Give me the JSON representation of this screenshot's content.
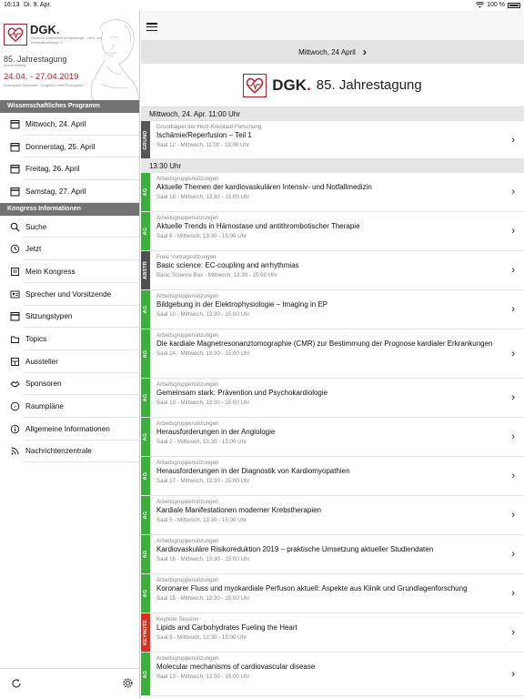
{
  "status": {
    "time": "16:13",
    "date": "Di. 9. Apr.",
    "battery": "100 %"
  },
  "banner": {
    "brand": "DGK",
    "society": "Deutsche Gesellschaft für Kardiologie – Herz- und Kreislaufforschung e.V.",
    "anniversary": "85. Jahrestagung",
    "annual": "Annual Meeting",
    "dates": "24.04. - 27.04.2019",
    "venue": "Rosengarten Mannheim · Congress Center Rosengarten"
  },
  "sidebar": {
    "section1": "Wissenschaftliches Programm",
    "days": [
      {
        "label": "Mittwoch, 24. April",
        "icon": "calendar-icon"
      },
      {
        "label": "Donnerstag, 25. April",
        "icon": "calendar-icon"
      },
      {
        "label": "Freitag, 26. April",
        "icon": "calendar-icon"
      },
      {
        "label": "Samstag, 27. April",
        "icon": "calendar-icon"
      }
    ],
    "section2": "Kongress Informationen",
    "items": [
      {
        "label": "Suche",
        "icon": "search-icon"
      },
      {
        "label": "Jetzt",
        "icon": "clock-icon"
      },
      {
        "label": "Mein Kongress",
        "icon": "my-congress-icon"
      },
      {
        "label": "Sprecher und Vorsitzende",
        "icon": "speakers-icon"
      },
      {
        "label": "Sitzungstypen",
        "icon": "session-types-icon"
      },
      {
        "label": "Topics",
        "icon": "topics-icon"
      },
      {
        "label": "Aussteller",
        "icon": "exhibitors-icon"
      },
      {
        "label": "Sponsoren",
        "icon": "sponsors-icon"
      },
      {
        "label": "Raumpläne",
        "icon": "location-icon"
      },
      {
        "label": "Allgemeine Informationen",
        "icon": "info-icon"
      },
      {
        "label": "Nachrichtenzentrale",
        "icon": "news-icon"
      }
    ]
  },
  "main": {
    "day_nav": "Mittwoch, 24 April",
    "logo_brand": "DGK",
    "logo_title": "85. Jahrestagung",
    "time1": "Mittwoch, 24. Apr. 11:00 Uhr",
    "time2": "13:30 Uhr",
    "sessions": [
      {
        "tag": "GRUND",
        "cat": "Grundlagen der Herz-Kreislauf-Forschung",
        "title": "Ischämie/Reperfusion – Teil 1",
        "meta": "Saal 12 - Mittwoch, 11:00 - 13:00 Uhr"
      },
      {
        "tag": "AG",
        "cat": "Arbeitsgruppensitzungen",
        "title": "Aktuelle Themen der kardiovaskulären Intensiv- und Notfallmedizin",
        "meta": "Saal 18 - Mittwoch, 13:30 - 15:00 Uhr"
      },
      {
        "tag": "AG",
        "cat": "Arbeitsgruppensitzungen",
        "title": "Aktuelle Trends in Hämostase und antithrombotischer Therapie",
        "meta": "Saal 6 - Mittwoch, 13:30 - 15:00 Uhr"
      },
      {
        "tag": "ABSTR",
        "cat": "Freie Vortragssitzungen",
        "title": "Basic science: EC-coupling and arrhythmias",
        "meta": "Basic Science Box - Mittwoch, 13:30 - 15:00 Uhr"
      },
      {
        "tag": "AG",
        "cat": "Arbeitsgruppensitzungen",
        "title": "Bildgebung in der Elektrophysiologie – Imaging in EP",
        "meta": "Saal 10 - Mittwoch, 13:30 - 15:00 Uhr"
      },
      {
        "tag": "AG",
        "cat": "Arbeitsgruppensitzungen",
        "title": "Die kardiale Magnetresonanztomographie (CMR) zur Bestimmung der Prognose kardialer Erkrankungen",
        "meta": "Saal 14 - Mittwoch, 13:30 - 15:00 Uhr"
      },
      {
        "tag": "AG",
        "cat": "Arbeitsgruppensitzungen",
        "title": "Gemeinsam stark: Prävention und Psychokardiologie",
        "meta": "Saal 19 - Mittwoch, 13:30 - 15:00 Uhr"
      },
      {
        "tag": "AG",
        "cat": "Arbeitsgruppensitzungen",
        "title": "Herausforderungen in der Angiologie",
        "meta": "Saal 2 - Mittwoch, 13:30 - 15:00 Uhr"
      },
      {
        "tag": "AG",
        "cat": "Arbeitsgruppensitzungen",
        "title": "Herausforderungen in der Diagnostik von Kardiomyopathien",
        "meta": "Saal 17 - Mittwoch, 13:30 - 15:00 Uhr"
      },
      {
        "tag": "AG",
        "cat": "Arbeitsgruppensitzungen",
        "title": "Kardiale Manifestationen moderner Krebstherapien",
        "meta": "Saal 5 - Mittwoch, 13:30 - 15:00 Uhr"
      },
      {
        "tag": "AG",
        "cat": "Arbeitsgruppensitzungen",
        "title": "Kardiovaskuläre Risikoreduktion 2019 – praktische Umsetzung aktueller Studiendaten",
        "meta": "Saal 16 - Mittwoch, 13:30 - 15:00 Uhr"
      },
      {
        "tag": "AG",
        "cat": "Arbeitsgruppensitzungen",
        "title": "Koronarer Fluss und myokardiale Perfuson aktuell: Aspekte aus Klinik und Grundlagenforschung",
        "meta": "Saal 15 - Mittwoch, 13:30 - 15:00 Uhr"
      },
      {
        "tag": "KEYNOTE",
        "cat": "Keynote Session",
        "title": "Lipids and Carbohydrates Fueling the Heart",
        "meta": "Saal 9 - Mittwoch, 13:30 - 15:00 Uhr"
      },
      {
        "tag": "AG",
        "cat": "Arbeitsgruppensitzungen",
        "title": "Molecular mechanisms of cardiovascular disease",
        "meta": "Saal 13 - Mittwoch, 13:30 - 15:00 Uhr"
      }
    ]
  },
  "colors": {
    "brand": "#b11f31",
    "ag": "#3cae3c",
    "keynote": "#d92f1f",
    "grund": "#555555",
    "section": "#727272"
  }
}
